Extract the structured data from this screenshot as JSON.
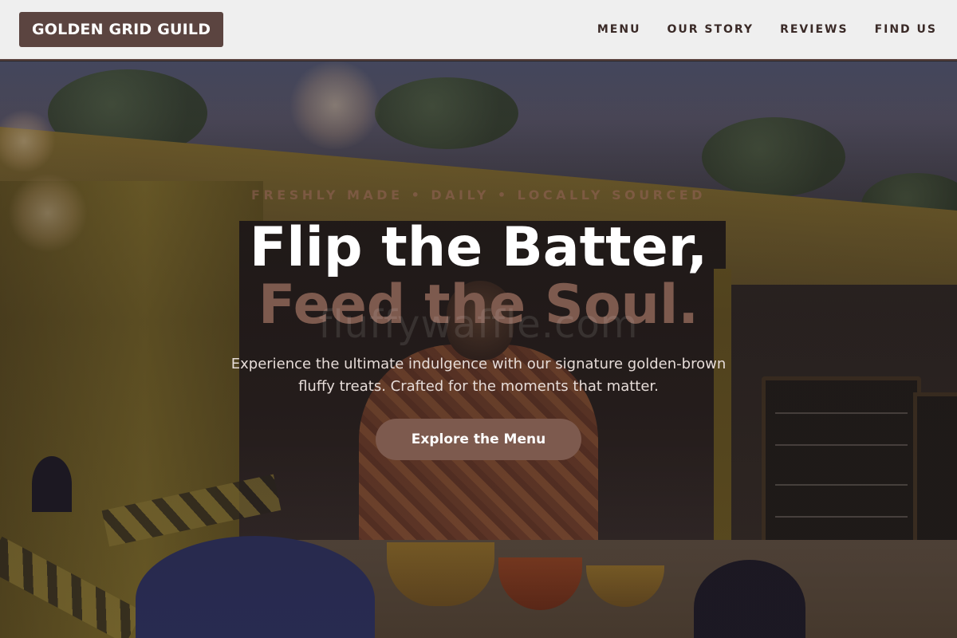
{
  "brand": {
    "name": "GOLDEN GRID GUILD"
  },
  "nav": {
    "items": [
      {
        "label": "MENU"
      },
      {
        "label": "OUR STORY"
      },
      {
        "label": "REVIEWS"
      },
      {
        "label": "FIND US"
      }
    ]
  },
  "hero": {
    "tagline": "FRESHLY MADE • DAILY • LOCALLY SOURCED",
    "headline_line1": "Flip the Batter,",
    "headline_line2": "Feed the Soul.",
    "watermark": "fluffywaffle.com",
    "subtext": "Experience the ultimate indulgence with our signature golden-brown fluffy treats. Crafted for the moments that matter.",
    "cta_label": "Explore the Menu"
  },
  "colors": {
    "brand": "#5b4440",
    "accent": "#7d5a4e",
    "nav_bg": "#efefef",
    "headline": "#ffffff"
  }
}
